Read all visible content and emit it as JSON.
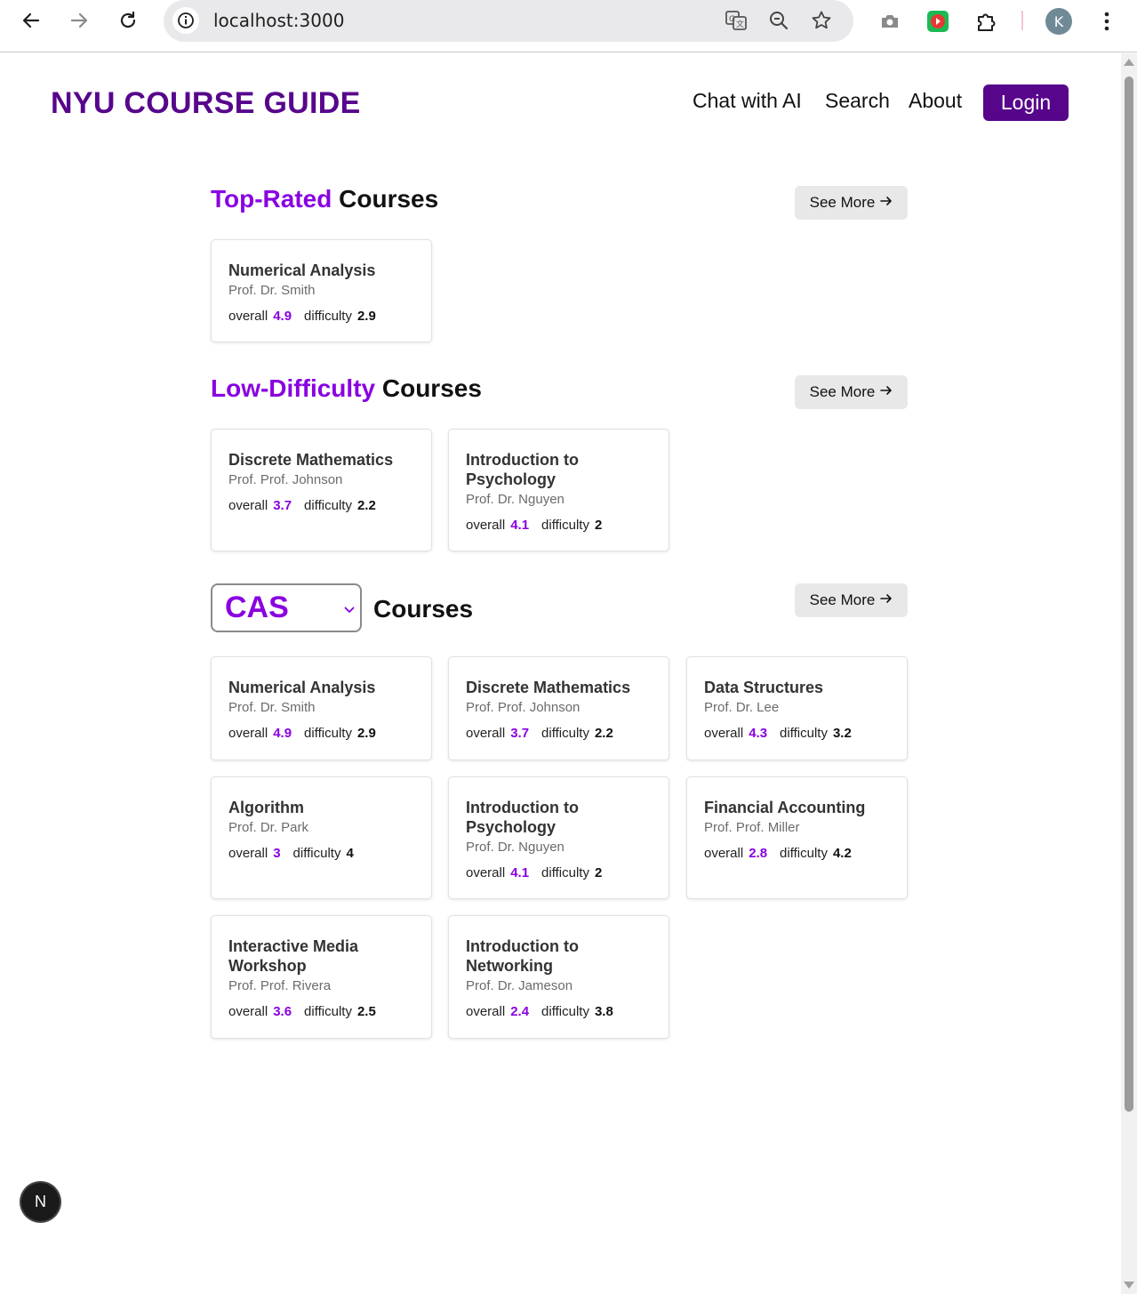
{
  "browser": {
    "url": "localhost:3000",
    "profile_initial": "K"
  },
  "header": {
    "brand": "NYU COURSE GUIDE",
    "nav": {
      "chat": "Chat with AI",
      "search": "Search",
      "about": "About",
      "login": "Login"
    }
  },
  "colors": {
    "brand": "#57068c",
    "accent": "#8900e1"
  },
  "see_more_label": "See More",
  "sections": {
    "top_rated": {
      "accent": "Top-Rated",
      "rest": "Courses",
      "courses": [
        {
          "title": "Numerical Analysis",
          "prof": "Prof. Dr. Smith",
          "overall": "4.9",
          "difficulty": "2.9"
        }
      ]
    },
    "low_difficulty": {
      "accent": "Low-Difficulty",
      "rest": "Courses",
      "courses": [
        {
          "title": "Discrete Mathematics",
          "prof": "Prof. Prof. Johnson",
          "overall": "3.7",
          "difficulty": "2.2"
        },
        {
          "title": "Introduction to Psychology",
          "prof": "Prof. Dr. Nguyen",
          "overall": "4.1",
          "difficulty": "2"
        }
      ]
    },
    "school": {
      "selected": "CAS",
      "rest": "Courses",
      "courses": [
        {
          "title": "Numerical Analysis",
          "prof": "Prof. Dr. Smith",
          "overall": "4.9",
          "difficulty": "2.9"
        },
        {
          "title": "Discrete Mathematics",
          "prof": "Prof. Prof. Johnson",
          "overall": "3.7",
          "difficulty": "2.2"
        },
        {
          "title": "Data Structures",
          "prof": "Prof. Dr. Lee",
          "overall": "4.3",
          "difficulty": "3.2"
        },
        {
          "title": "Algorithm",
          "prof": "Prof. Dr. Park",
          "overall": "3",
          "difficulty": "4"
        },
        {
          "title": "Introduction to Psychology",
          "prof": "Prof. Dr. Nguyen",
          "overall": "4.1",
          "difficulty": "2"
        },
        {
          "title": "Financial Accounting",
          "prof": "Prof. Prof. Miller",
          "overall": "2.8",
          "difficulty": "4.2"
        },
        {
          "title": "Interactive Media Workshop",
          "prof": "Prof. Prof. Rivera",
          "overall": "3.6",
          "difficulty": "2.5"
        },
        {
          "title": "Introduction to Networking",
          "prof": "Prof. Dr. Jameson",
          "overall": "2.4",
          "difficulty": "3.8"
        }
      ]
    }
  },
  "labels": {
    "overall": "overall",
    "difficulty": "difficulty"
  },
  "dev_badge": "N"
}
